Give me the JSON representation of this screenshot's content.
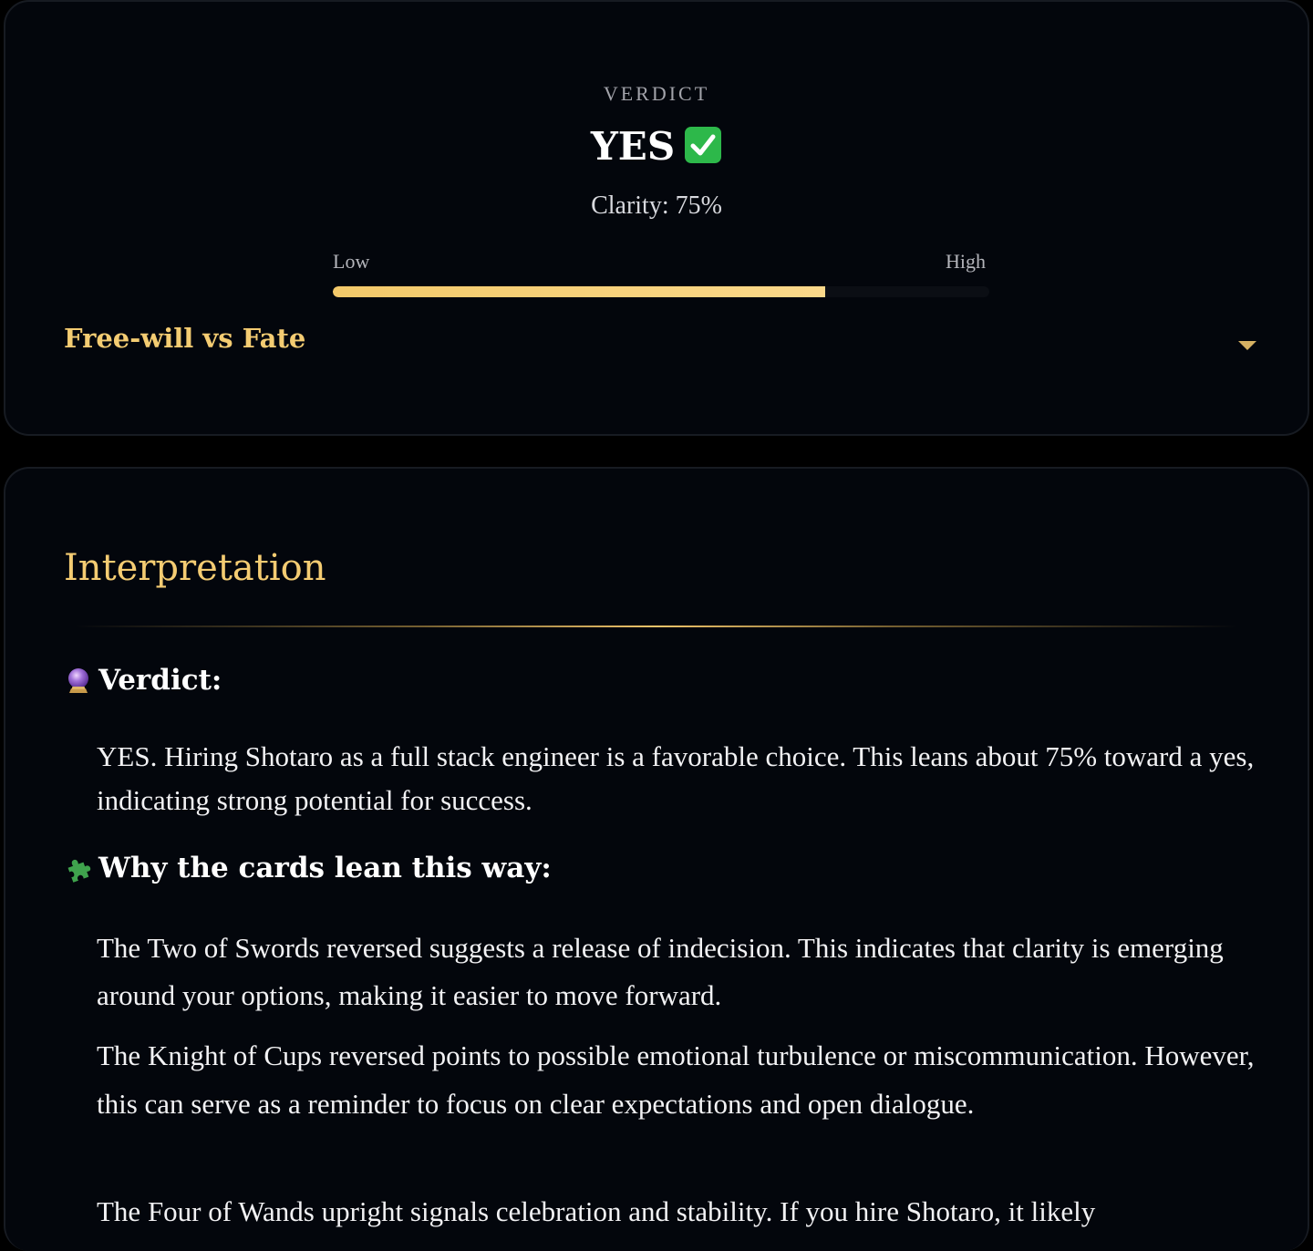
{
  "verdict_card": {
    "label": "VERDICT",
    "answer": "YES",
    "answer_icon": "check-mark-icon",
    "clarity_text": "Clarity: 75%",
    "clarity_value": 0.75,
    "scale_low": "Low",
    "scale_high": "High",
    "fate_title": "Free-will vs Fate",
    "fate_icon": "caret-down-icon"
  },
  "interpretation": {
    "title": "Interpretation",
    "verdict_heading": {
      "icon": "crystal-ball-icon",
      "text": "Verdict:"
    },
    "verdict_text": "YES. Hiring Shotaro as a full stack engineer is a favorable choice. This leans about 75% toward a yes, indicating strong potential for success.",
    "why_heading": {
      "icon": "puzzle-piece-icon",
      "text": "Why the cards lean this way:"
    },
    "why_paragraphs": [
      "The Two of Swords reversed suggests a release of indecision. This indicates that clarity is emerging around your options, making it easier to move forward.",
      "The Knight of Cups reversed points to possible emotional turbulence or miscommunication. However, this can serve as a reminder to focus on clear expectations and open dialogue.",
      "The Four of Wands upright signals celebration and stability. If you hire Shotaro, it likely"
    ]
  },
  "colors": {
    "background": "#000000",
    "card": "#03060c",
    "accent_gold": "#f4cc72",
    "bar_fill": "#f8d27e",
    "text": "#f2f2f4"
  }
}
